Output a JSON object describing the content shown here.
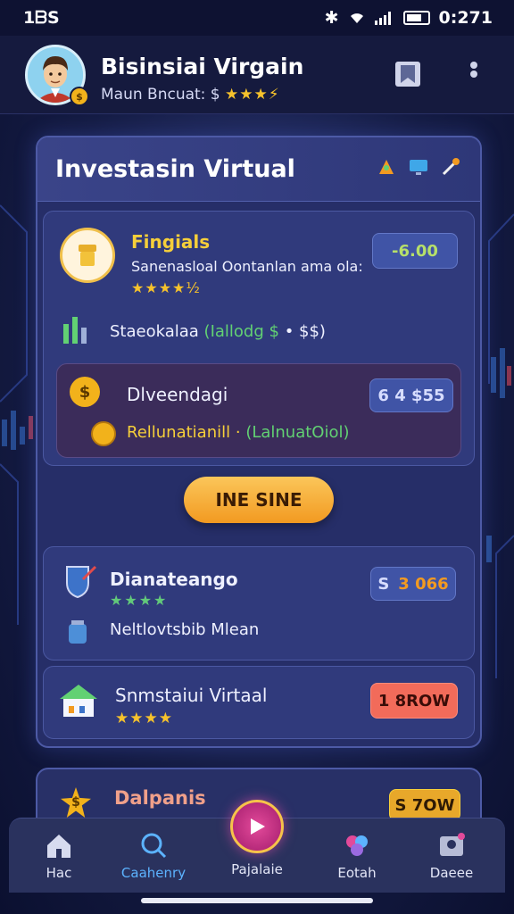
{
  "status_bar": {
    "time_left": "1ᗷS",
    "time_right": "0:271"
  },
  "header": {
    "user_name": "Bisinsiai Virgain",
    "user_sub": "Maun Bncuat: $",
    "user_stars": "★★★⚡"
  },
  "panel": {
    "title": "Investasin Virtual",
    "card1": {
      "title": "Fingials",
      "subtitle": "Sanenasloal Oontanlan ama ola:",
      "stars": "★★★★½",
      "value": "-6.00",
      "stat_label": "Staeokalaa",
      "stat_green": "(Iallodg $",
      "stat_extra": "• $$)",
      "inner": {
        "title": "Dlveendagi",
        "value": "6  4 $55",
        "line_yellow": "Rellunatianill ·",
        "line_green": "(LalnuatOiol)"
      }
    },
    "cta_label": "INE SINE",
    "card2": {
      "title": "Dianateango",
      "stars": "★★★★",
      "value_a": "S",
      "value_b": "3 066",
      "sub": "Neltlovtsbib Mlean"
    },
    "card3": {
      "title": "Snmstaiui Virtaal",
      "stars": "★★★★",
      "value": "1 8ROW"
    }
  },
  "bottom_card": {
    "title": "Dalpanis",
    "value": "S 7OW"
  },
  "nav": {
    "items": [
      {
        "label": "Hac"
      },
      {
        "label": "Caahenry"
      },
      {
        "label": "Pajalaie"
      },
      {
        "label": "Eotah"
      },
      {
        "label": "Daeee"
      }
    ]
  },
  "colors": {
    "accent": "#f6cf3a",
    "positive": "#62d173",
    "cta": "#f29a21",
    "alert": "#f26b5a"
  }
}
